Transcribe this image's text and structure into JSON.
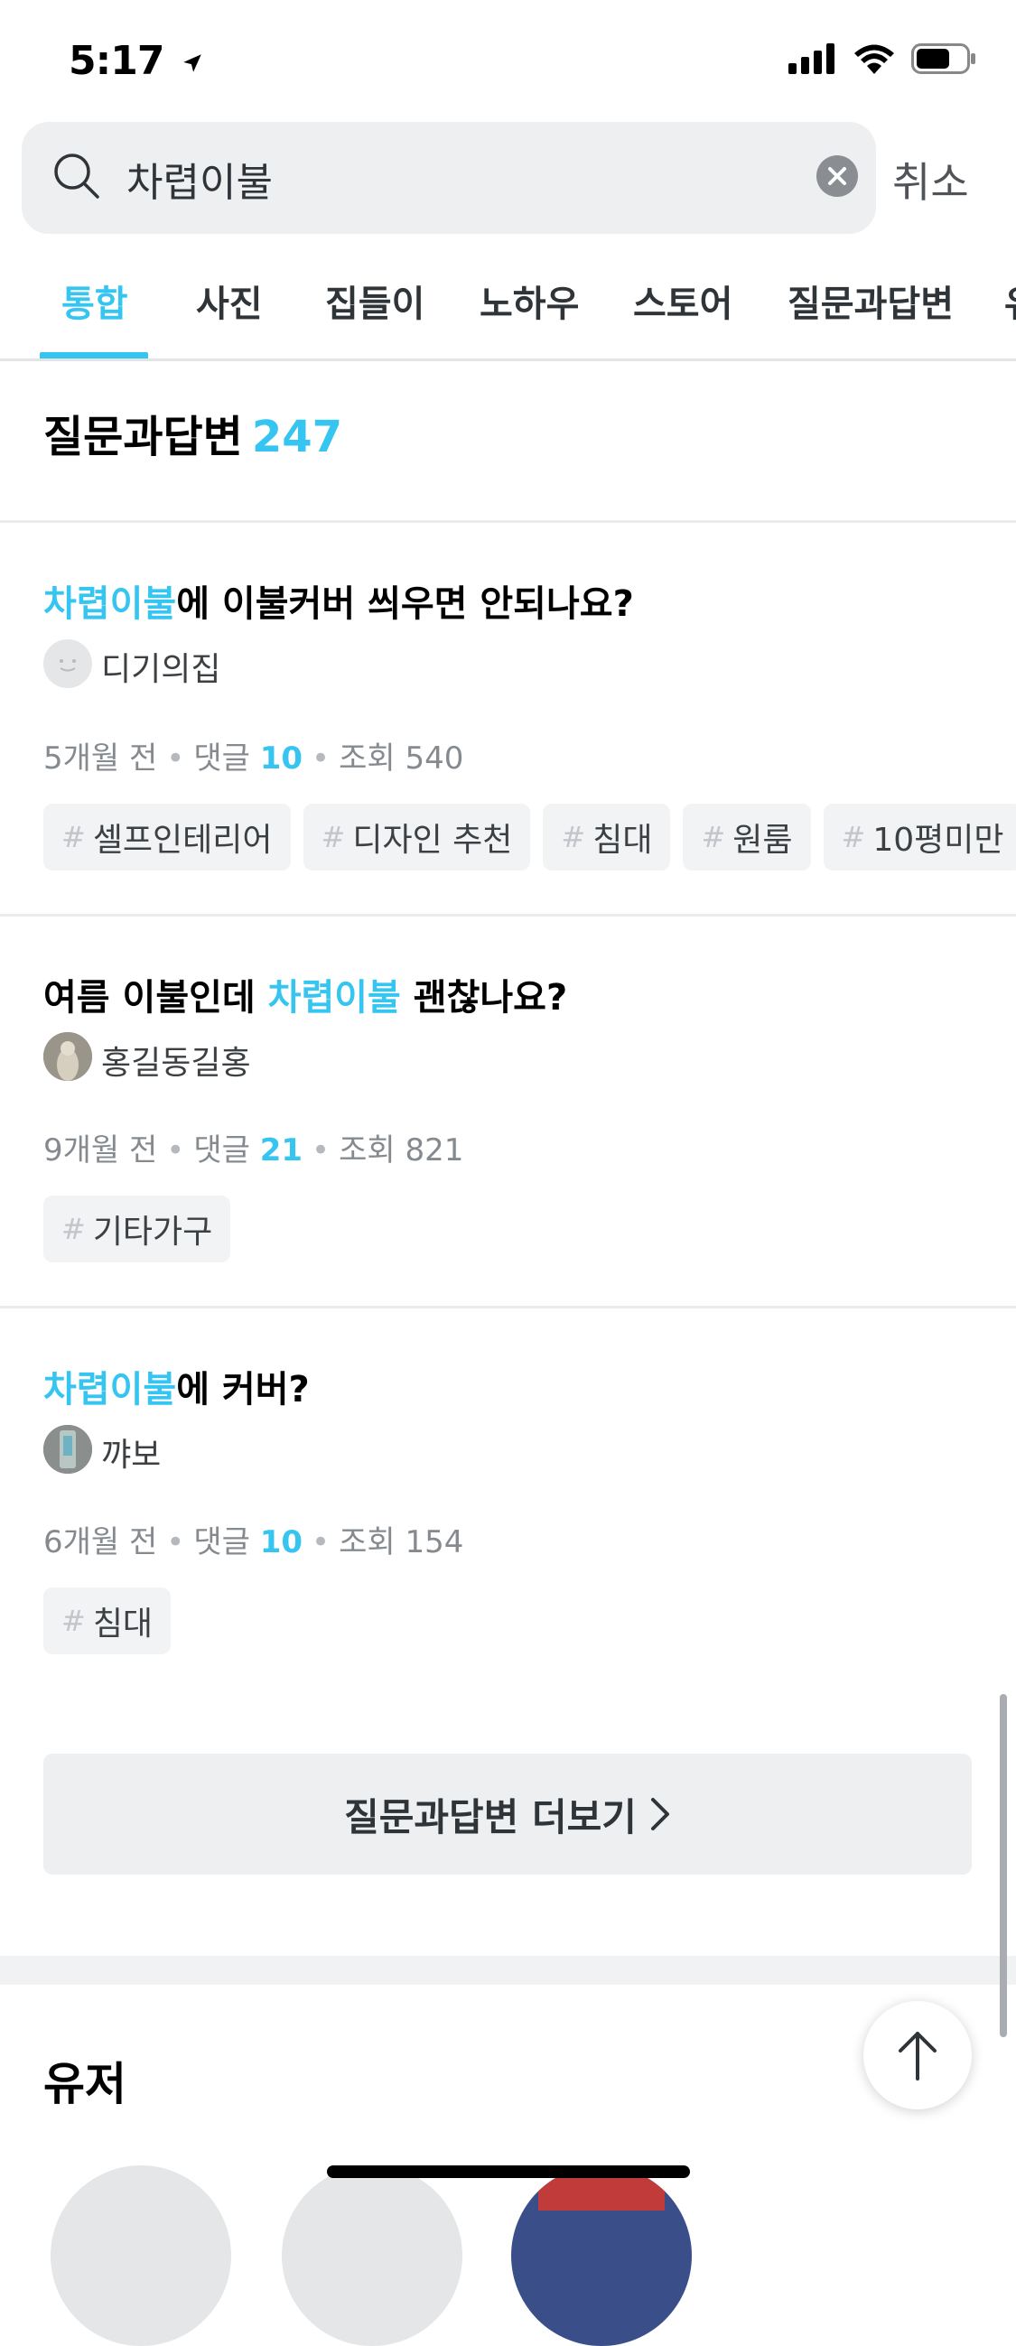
{
  "status_bar": {
    "time": "5:17"
  },
  "search": {
    "query": "차렵이불",
    "cancel_label": "취소"
  },
  "tabs": [
    {
      "label": "통합",
      "active": true
    },
    {
      "label": "사진",
      "active": false
    },
    {
      "label": "집들이",
      "active": false
    },
    {
      "label": "노하우",
      "active": false
    },
    {
      "label": "스토어",
      "active": false
    },
    {
      "label": "질문과답변",
      "active": false
    },
    {
      "label": "유",
      "active": false
    }
  ],
  "section": {
    "title": "질문과답변",
    "count": "247"
  },
  "questions": [
    {
      "title_highlight": "차렵이불",
      "title_rest": "에 이불커버 씌우면 안되나요?",
      "author": "디기의집",
      "time_ago": "5개월 전",
      "comments_label": "댓글",
      "comments": "10",
      "views_label": "조회",
      "views": "540",
      "tags": [
        "셀프인테리어",
        "디자인 추천",
        "침대",
        "원룸",
        "10평미만"
      ]
    },
    {
      "title_prefix": "여름 이불인데 ",
      "title_highlight": "차렵이불",
      "title_rest": " 괜찮나요?",
      "author": "홍길동길홍",
      "time_ago": "9개월 전",
      "comments_label": "댓글",
      "comments": "21",
      "views_label": "조회",
      "views": "821",
      "tags": [
        "기타가구"
      ]
    },
    {
      "title_highlight": "차렵이불",
      "title_rest": "에 커버?",
      "author": "꺄보",
      "time_ago": "6개월 전",
      "comments_label": "댓글",
      "comments": "10",
      "views_label": "조회",
      "views": "154",
      "tags": [
        "침대"
      ]
    }
  ],
  "more_button": {
    "label": "질문과답변 더보기"
  },
  "users_section": {
    "title": "유저"
  },
  "colors": {
    "accent": "#35c5f0",
    "text": "#2f3438",
    "muted": "#858a8f"
  }
}
